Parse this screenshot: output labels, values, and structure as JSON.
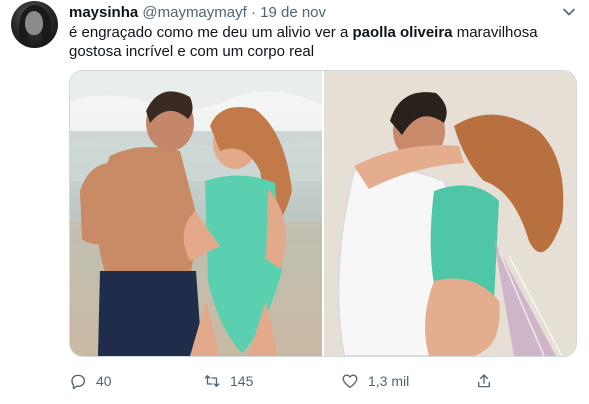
{
  "tweet": {
    "author_name": "maysinha",
    "author_handle": "@maymaymayf",
    "separator": "·",
    "timestamp": "19 de nov",
    "text_before": "é engraçado como me deu um alivio ver a ",
    "text_bold": "paolla oliveira",
    "text_after": " maravilhosa gostosa incrível e com um corpo real"
  },
  "actions": {
    "reply_count": "40",
    "retweet_count": "145",
    "like_count": "1,3 mil"
  },
  "icons": {
    "avatar": "avatar",
    "caret": "chevron-down-icon",
    "reply": "reply-icon",
    "retweet": "retweet-icon",
    "like": "heart-icon",
    "share": "share-icon"
  },
  "colors": {
    "text": "#0f1419",
    "secondary": "#536471",
    "border": "#cfd9de"
  }
}
